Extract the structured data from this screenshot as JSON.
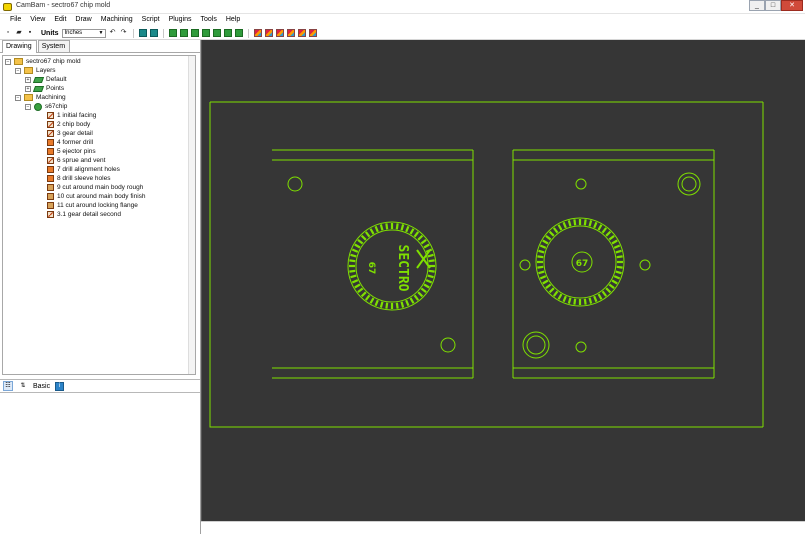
{
  "window": {
    "title": "CamBam - sectro67 chip mold",
    "minimize_label": "_",
    "maximize_label": "□",
    "close_label": "✕"
  },
  "menu": [
    "File",
    "View",
    "Edit",
    "Draw",
    "Machining",
    "Script",
    "Plugins",
    "Tools",
    "Help"
  ],
  "toolbar": {
    "units_label": "Units",
    "units_value": "Inches"
  },
  "tabs": {
    "drawing": "Drawing",
    "system": "System"
  },
  "tree": {
    "root": "sectro67 chip mold",
    "layers": "Layers",
    "layer_default": "Default",
    "layer_points": "Points",
    "machining": "Machining",
    "part": "s67chip",
    "operations": [
      "1 initial facing",
      "2 chip body",
      "3 gear detail",
      "4 former drill",
      "5 ejector pins",
      "6 sprue and vent",
      "7 drill alignment holes",
      "8 drill sleeve holes",
      "9 cut around main body rough",
      "10 cut around main body finish",
      "11 cut around locking flange",
      "3.1 gear detail second"
    ]
  },
  "properties": {
    "basic_label": "Basic"
  },
  "drawing": {
    "left_face_text": "SECTRO",
    "left_face_number": "67",
    "right_face_number": "67",
    "line_color": "#7fe000",
    "background_color": "#363636"
  }
}
